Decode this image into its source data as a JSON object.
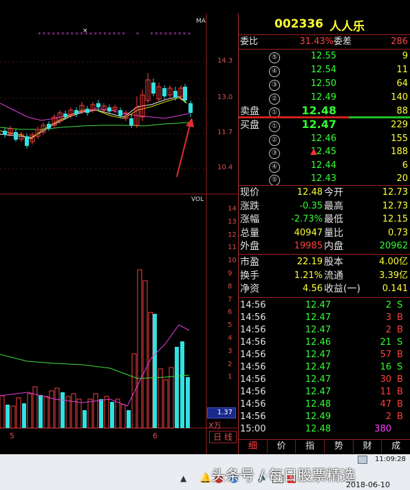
{
  "stock": {
    "code": "002336",
    "name": "人人乐"
  },
  "price_axis": {
    "labels": [
      "14.3",
      "13.0",
      "11.7",
      "10.4"
    ],
    "ma_label": "MA"
  },
  "vol_axis": {
    "labels": [
      "14",
      "13",
      "12",
      "11",
      "10",
      "9",
      "8",
      "7",
      "6",
      "5",
      "4",
      "3",
      "2",
      "1"
    ],
    "label": "VOL",
    "current": "1.37",
    "unit": "X万"
  },
  "date_axis": {
    "labels": [
      "5",
      "6"
    ],
    "period_tab": "日 线"
  },
  "committee": {
    "ratio_label": "委比",
    "ratio_value": "31.43%",
    "diff_label": "委差",
    "diff_value": "286"
  },
  "asks": [
    {
      "level": "⑤",
      "price": "12.55",
      "volume": "9"
    },
    {
      "level": "④",
      "price": "12.54",
      "volume": "11"
    },
    {
      "level": "③",
      "price": "12.50",
      "volume": "64"
    },
    {
      "level": "②",
      "price": "12.49",
      "volume": "140"
    },
    {
      "level": "①",
      "price": "12.48",
      "volume": "88",
      "side_label": "卖盘"
    }
  ],
  "bids": [
    {
      "level": "①",
      "price": "12.47",
      "volume": "229",
      "side_label": "买盘"
    },
    {
      "level": "②",
      "price": "12.46",
      "volume": "155"
    },
    {
      "level": "③",
      "price": "12.45",
      "volume": "188"
    },
    {
      "level": "④",
      "price": "12.44",
      "volume": "6"
    },
    {
      "level": "⑤",
      "price": "12.43",
      "volume": "20"
    }
  ],
  "quote": [
    {
      "l1": "现价",
      "v1": "12.48",
      "l2": "今开",
      "v2": "12.73"
    },
    {
      "l1": "涨跌",
      "v1": "-0.35",
      "l2": "最高",
      "v2": "12.73"
    },
    {
      "l1": "涨幅",
      "v1": "-2.73%",
      "l2": "最低",
      "v2": "12.15"
    },
    {
      "l1": "总量",
      "v1": "40947",
      "l2": "量比",
      "v2": "0.73"
    },
    {
      "l1": "外盘",
      "v1": "19985",
      "l2": "内盘",
      "v2": "20962"
    }
  ],
  "fundamentals": [
    {
      "l1": "市盈",
      "v1": "22.19",
      "l2": "股本",
      "v2": "4.00亿"
    },
    {
      "l1": "换手",
      "v1": "1.21%",
      "l2": "流通",
      "v2": "3.39亿"
    },
    {
      "l1": "净资",
      "v1": "4.56",
      "l2": "收益(一)",
      "v2": "0.141"
    }
  ],
  "ticks": [
    {
      "time": "14:56",
      "price": "12.47",
      "vol": "2",
      "side": "S"
    },
    {
      "time": "14:56",
      "price": "12.47",
      "vol": "3",
      "side": "B"
    },
    {
      "time": "14:56",
      "price": "12.47",
      "vol": "2",
      "side": "B"
    },
    {
      "time": "14:56",
      "price": "12.46",
      "vol": "21",
      "side": "S"
    },
    {
      "time": "14:56",
      "price": "12.47",
      "vol": "57",
      "side": "B"
    },
    {
      "time": "14:56",
      "price": "12.47",
      "vol": "16",
      "side": "S"
    },
    {
      "time": "14:56",
      "price": "12.47",
      "vol": "30",
      "side": "B"
    },
    {
      "time": "14:56",
      "price": "12.47",
      "vol": "11",
      "side": "B"
    },
    {
      "time": "14:56",
      "price": "12.48",
      "vol": "47",
      "side": "B"
    },
    {
      "time": "14:56",
      "price": "12.49",
      "vol": "2",
      "side": "B"
    },
    {
      "time": "15:00",
      "price": "12.48",
      "vol": "380",
      "side": ""
    }
  ],
  "tabs": [
    "细",
    "价",
    "指",
    "势",
    "财",
    "成"
  ],
  "taskbar": {
    "clock": "11:09:28",
    "date": "2018-06-10",
    "watermark": "头条号 / 每日股票精选"
  }
}
